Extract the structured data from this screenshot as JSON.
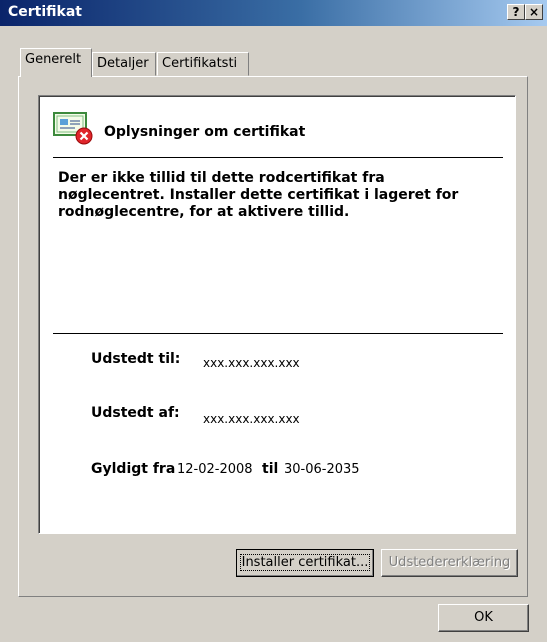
{
  "window": {
    "title": "Certifikat",
    "help_button": "?",
    "close_button": "×"
  },
  "tabs": [
    {
      "label": "Generelt",
      "active": true
    },
    {
      "label": "Detaljer",
      "active": false
    },
    {
      "label": "Certifikatsti",
      "active": false
    }
  ],
  "info": {
    "icon": "certificate-error-icon",
    "heading": "Oplysninger om certifikat",
    "message": "Der er ikke tillid til dette rodcertifikat fra nøglecentret. Installer dette certifikat i lageret for rodnøglecentre, for at aktivere tillid.",
    "issued_to_label": "Udstedt til:",
    "issued_to_value": "xxx.xxx.xxx.xxx",
    "issued_by_label": "Udstedt af:",
    "issued_by_value": "xxx.xxx.xxx.xxx",
    "valid_from_label": "Gyldigt fra",
    "valid_from_value": "12-02-2008",
    "valid_to_label": "til",
    "valid_to_value": "30-06-2035"
  },
  "buttons": {
    "install": "Installer certifikat...",
    "issuer_statement": "Udstedererklæring",
    "ok": "OK"
  },
  "colors": {
    "titlebar_start": "#0a246a",
    "titlebar_end": "#a6caf0",
    "dialog_face": "#d4d0c8",
    "error_badge": "#e0252b"
  }
}
